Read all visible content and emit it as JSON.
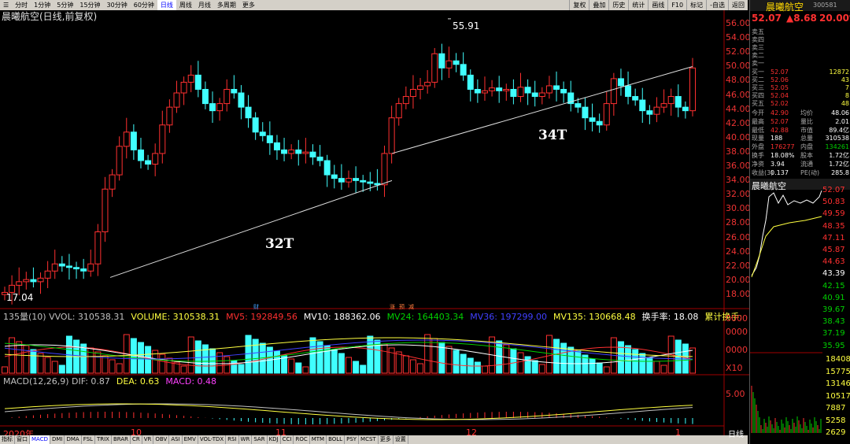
{
  "toolbar": {
    "periods": [
      "分时",
      "1分钟",
      "5分钟",
      "15分钟",
      "30分钟",
      "60分钟",
      "日线",
      "周线",
      "月线",
      "多周期",
      "更多"
    ],
    "active_period": "日线",
    "right_buttons": [
      "复权",
      "叠加",
      "历史",
      "统计",
      "画线",
      "F10",
      "标记",
      "-自选",
      "返回"
    ]
  },
  "chart": {
    "title": "晨曦航空(日线,前复权)",
    "high_label": "55.91",
    "low_label": "17.04",
    "annotation_32t": "32T",
    "annotation_34t": "34T",
    "price_axis": [
      "56.00",
      "54.00",
      "52.00",
      "50.00",
      "48.00",
      "46.00",
      "44.00",
      "42.00",
      "40.00",
      "38.00",
      "36.00",
      "34.00",
      "32.00",
      "30.00",
      "28.00",
      "26.00",
      "24.00",
      "22.00",
      "20.00",
      "18.00"
    ],
    "date_labels": [
      "2020年",
      "10",
      "11",
      "12",
      "1"
    ],
    "markers": [
      "财",
      "涨",
      "预",
      "减"
    ]
  },
  "volume": {
    "title_parts": [
      {
        "text": "135量(10) VVOL: 310538.31",
        "color": "#c0c0c0"
      },
      {
        "text": "VOLUME: 310538.31",
        "color": "#ffff40"
      },
      {
        "text": "MV5: 192849.56",
        "color": "#ff3030"
      },
      {
        "text": "MV10: 188362.06",
        "color": "#ffffff"
      },
      {
        "text": "MV24: 164403.34",
        "color": "#00d000"
      },
      {
        "text": "MV36: 197299.00",
        "color": "#4040ff"
      },
      {
        "text": "MV135: 130668.48",
        "color": "#ffff40"
      },
      {
        "text": "换手率: 18.08",
        "color": "#ffffff"
      },
      {
        "text": "累计换手:",
        "color": "#ffff40"
      }
    ],
    "axis": [
      "0000",
      "0000",
      "0000",
      "X10"
    ]
  },
  "macd": {
    "title_parts": [
      {
        "text": "MACD(12,26,9) DIF: 0.87",
        "color": "#c0c0c0"
      },
      {
        "text": "DEA: 0.63",
        "color": "#ffff40"
      },
      {
        "text": "MACD: 0.48",
        "color": "#ff40ff"
      }
    ],
    "axis": [
      "5.00"
    ]
  },
  "bottom_tabs": [
    "指标",
    "窗口",
    "MACD",
    "DMI",
    "DMA",
    "FSL",
    "TRIX",
    "BRAR",
    "CR",
    "VR",
    "OBV",
    "ASI",
    "EMV",
    "VOL-TDX",
    "RSI",
    "WR",
    "SAR",
    "KDJ",
    "CCI",
    "ROC",
    "MTM",
    "BOLL",
    "PSY",
    "MCST",
    "更多",
    "设置"
  ],
  "active_tab": "MACD",
  "quote": {
    "name": "晨曦航空",
    "code": "300581",
    "price": "52.07",
    "change": "▲8.68",
    "pct": "20.00%",
    "asks": [
      {
        "label": "卖五",
        "price": "",
        "vol": ""
      },
      {
        "label": "卖四",
        "price": "",
        "vol": ""
      },
      {
        "label": "卖三",
        "price": "",
        "vol": ""
      },
      {
        "label": "卖二",
        "price": "",
        "vol": ""
      },
      {
        "label": "卖一",
        "price": "",
        "vol": ""
      }
    ],
    "bids": [
      {
        "label": "买一",
        "price": "52.07",
        "vol": "12872"
      },
      {
        "label": "买二",
        "price": "52.06",
        "vol": "43"
      },
      {
        "label": "买三",
        "price": "52.05",
        "vol": "7"
      },
      {
        "label": "买四",
        "price": "52.04",
        "vol": "8"
      },
      {
        "label": "买五",
        "price": "52.02",
        "vol": "48"
      }
    ],
    "stats": [
      {
        "l1": "今开",
        "v1": "42.90",
        "l2": "均价",
        "v2": "48.06"
      },
      {
        "l1": "最高",
        "v1": "52.07",
        "l2": "量比",
        "v2": "2.01"
      },
      {
        "l1": "最低",
        "v1": "42.88",
        "l2": "市值",
        "v2": "89.4亿"
      },
      {
        "l1": "现量",
        "v1": "188",
        "l2": "总量",
        "v2": "310538"
      },
      {
        "l1": "外盘",
        "v1": "176277",
        "l2": "内盘",
        "v2": "134261"
      },
      {
        "l1": "换手",
        "v1": "18.08%",
        "l2": "股本",
        "v2": "1.72亿"
      },
      {
        "l1": "净资",
        "v1": "3.94",
        "l2": "流通",
        "v2": "1.72亿"
      },
      {
        "l1": "收益(3)",
        "v1": "0.137",
        "l2": "PE(动)",
        "v2": "285.8"
      }
    ],
    "mini_title": "晨曦航空",
    "mini_axis": [
      "52.07",
      "50.83",
      "49.59",
      "48.35",
      "47.11",
      "45.87",
      "44.63",
      "43.39",
      "42.15",
      "40.91",
      "39.67",
      "38.43",
      "37.19",
      "35.95"
    ],
    "mini_vol_axis": [
      "18408",
      "15775",
      "13146",
      "10517",
      "7887",
      "5258",
      "2629"
    ],
    "mini_tab": "日线"
  }
}
